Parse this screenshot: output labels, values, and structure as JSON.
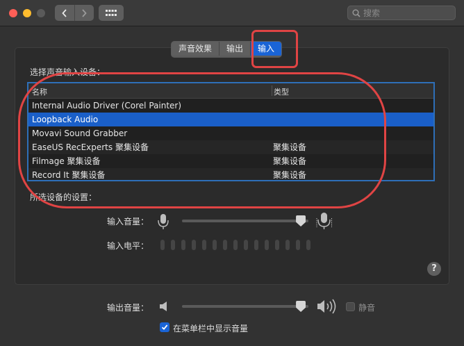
{
  "search": {
    "placeholder": "搜索"
  },
  "tabs": [
    {
      "label": "声音效果",
      "active": false
    },
    {
      "label": "输出",
      "active": false
    },
    {
      "label": "输入",
      "active": true
    }
  ],
  "input_section": {
    "title": "选择声音输入设备：",
    "columns": {
      "name": "名称",
      "type": "类型"
    },
    "devices": [
      {
        "name": "Internal Audio Driver (Corel Painter)",
        "type": "",
        "selected": false
      },
      {
        "name": "Loopback Audio",
        "type": "",
        "selected": true
      },
      {
        "name": "Movavi Sound Grabber",
        "type": "",
        "selected": false
      },
      {
        "name": "EaseUS RecExperts 聚集设备",
        "type": "聚集设备",
        "selected": false
      },
      {
        "name": "Filmage 聚集设备",
        "type": "聚集设备",
        "selected": false
      },
      {
        "name": "Record It 聚集设备",
        "type": "聚集设备",
        "selected": false
      }
    ]
  },
  "device_settings": {
    "title": "所选设备的设置：",
    "input_volume_label": "输入音量：",
    "input_volume": 0.94,
    "input_level_label": "输入电平："
  },
  "output": {
    "volume_label": "输出音量：",
    "volume": 0.94,
    "mute_label": "静音",
    "mute": false,
    "show_in_menubar_label": "在菜单栏中显示音量",
    "show_in_menubar": true
  },
  "colors": {
    "accent": "#1a64d6",
    "annotation": "#e04444"
  }
}
